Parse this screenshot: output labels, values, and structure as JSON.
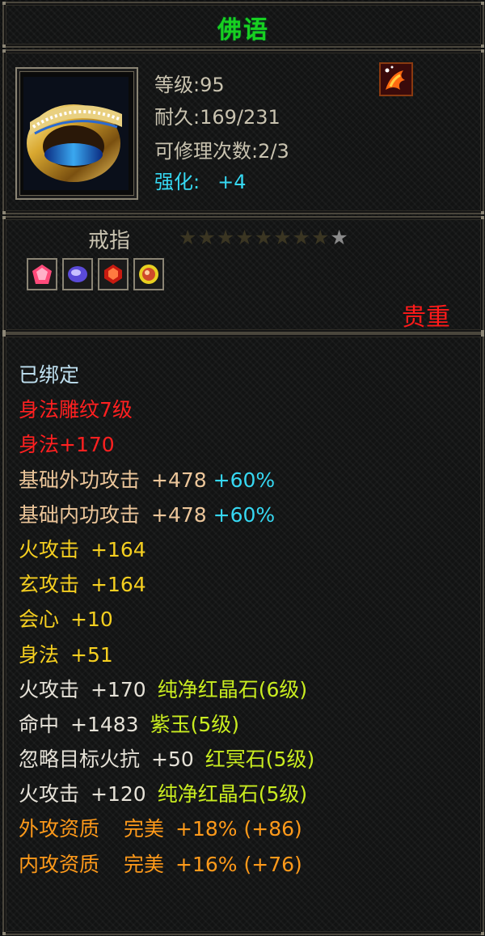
{
  "item": {
    "name": "佛语",
    "level_label": "等级",
    "level": "95",
    "durability_label": "耐久",
    "durability": "169/231",
    "repair_label": "可修理次数",
    "repair": "2/3",
    "enhance_label": "强化:",
    "enhance": "+4",
    "type": "戒指",
    "stars_filled": 8,
    "stars_total": 9,
    "rarity": "贵重",
    "gem_icons": [
      "pink-gem-icon",
      "purple-gem-icon",
      "red-gem-icon",
      "green-gem-icon"
    ]
  },
  "attributes": {
    "bound": "已绑定",
    "carving": "身法雕纹7级",
    "carving_bonus": "身法+170",
    "base_ext": {
      "name": "基础外功攻击",
      "value": "+478",
      "pct": "+60%"
    },
    "base_int": {
      "name": "基础内功攻击",
      "value": "+478",
      "pct": "+60%"
    },
    "fire_atk": {
      "name": "火攻击",
      "value": "+164"
    },
    "xuan_atk": {
      "name": "玄攻击",
      "value": "+164"
    },
    "crit": {
      "name": "会心",
      "value": "+10"
    },
    "agility": {
      "name": "身法",
      "value": "+51"
    },
    "gem1": {
      "name": "火攻击",
      "value": "+170",
      "gem": "纯净红晶石(6级)"
    },
    "gem2": {
      "name": "命中",
      "value": "+1483",
      "gem": "紫玉(5级)"
    },
    "gem3": {
      "name": "忽略目标火抗",
      "value": "+50",
      "gem": "红冥石(5级)"
    },
    "gem4": {
      "name": "火攻击",
      "value": "+120",
      "gem": "纯净红晶石(5级)"
    },
    "apt1": {
      "name": "外攻资质",
      "quality": "完美",
      "value": "+18%",
      "extra": "(+86)"
    },
    "apt2": {
      "name": "内攻资质",
      "quality": "完美",
      "value": "+16%",
      "extra": "(+76)"
    }
  },
  "colors": {
    "title": "#18d020",
    "enhance": "#36d8f2",
    "rarity": "#ff1a1a",
    "red_text": "#ff2020",
    "yellow_text": "#f5cf20",
    "gem_text": "#c9ec20",
    "aptitude_text": "#ff9a1a"
  }
}
